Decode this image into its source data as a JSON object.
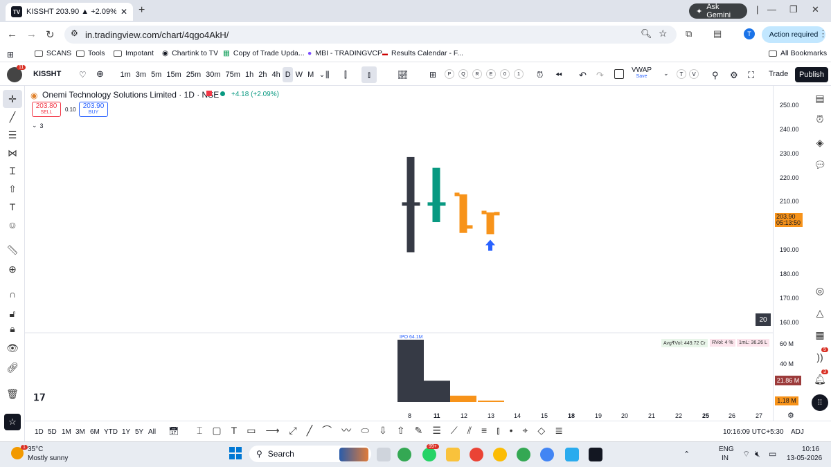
{
  "browser": {
    "tab_title": "KISSHT 203.90 ▲ +2.09% VWAP",
    "tab_icon": "TV",
    "new_tab": "+",
    "ask_gemini": "Ask Gemini",
    "url": "in.tradingview.com/chart/4qgo4AkH/",
    "profile_initial": "T",
    "action_required": "Action required"
  },
  "bookmarks": [
    "SCANS",
    "Tools",
    "Impotant",
    "Chartink to TV",
    "Copy of Trade Upda...",
    "MBI - TRADINGVCP",
    "Results Calendar - F..."
  ],
  "all_bookmarks": "All Bookmarks",
  "tv_toolbar": {
    "symbol": "KISSHT",
    "intervals": [
      "1m",
      "3m",
      "5m",
      "15m",
      "25m",
      "30m",
      "75m",
      "1h",
      "2h",
      "4h",
      "D",
      "W",
      "M"
    ],
    "active_interval": "D",
    "letters": [
      "P",
      "Q",
      "R",
      "E",
      "0",
      "1"
    ],
    "vwap": "VWAP",
    "vwap_save": "Save",
    "extra_letters": [
      "T",
      "V"
    ],
    "trade": "Trade",
    "publish": "Publish",
    "avatar_badge": "11"
  },
  "legend": {
    "title": "Onemi Technology Solutions Limited · 1D · NSE",
    "change": "+4.18 (+2.09%)",
    "sell_price": "203.80",
    "sell_label": "SELL",
    "spread": "0.10",
    "buy_price": "203.90",
    "buy_label": "BUY",
    "indicators_count": "3"
  },
  "price_axis": [
    "250.00",
    "240.00",
    "230.00",
    "220.00",
    "210.00",
    "190.00",
    "180.00",
    "170.00",
    "160.00"
  ],
  "price_tag": {
    "price": "203.90",
    "timer": "05:13:50"
  },
  "time_axis": [
    "8",
    "11",
    "12",
    "13",
    "14",
    "15",
    "18",
    "19",
    "20",
    "21",
    "22",
    "25",
    "26",
    "27"
  ],
  "bold_time_labels": [
    "11",
    "18",
    "25"
  ],
  "badge_20": "20",
  "volume": {
    "ipo_label": "IPO 64.1M",
    "avg_vol": "Avg₹Vol: 449.72 Cr",
    "rvol": "RVol: 4 %",
    "iml": "1mL: 36.26 L",
    "axis": [
      "60 M",
      "40 M"
    ],
    "tag_main": "21.86 M",
    "tag_small": "1.18 M"
  },
  "chart_data": {
    "type": "ohlc",
    "categories": [
      "8",
      "11",
      "12",
      "13"
    ],
    "ohlc": [
      {
        "x": "8",
        "open": 209,
        "high": 228.5,
        "low": 189,
        "close": 209
      },
      {
        "x": "11",
        "open": 209,
        "high": 224,
        "low": 201.5,
        "close": 209
      },
      {
        "x": "12",
        "open": 213,
        "high": 213,
        "low": 197,
        "close": 199.5
      },
      {
        "x": "13",
        "open": 205.5,
        "high": 205.5,
        "low": 196.5,
        "close": 205
      }
    ],
    "volume": [
      64.1,
      21.86,
      6.5,
      1.18
    ],
    "ylim": [
      157,
      255
    ],
    "colors": {
      "down": "#363a45",
      "up": "#089981",
      "orange": "#f7931a",
      "arrow": "#2962ff"
    }
  },
  "bottom_ranges": [
    "1D",
    "5D",
    "1M",
    "3M",
    "6M",
    "YTD",
    "1Y",
    "5Y",
    "All"
  ],
  "clock": "10:16:09 UTC+5:30",
  "adj": "ADJ",
  "taskbar": {
    "temp": "35°C",
    "weather": "Mostly sunny",
    "weather_badge": "1",
    "search": "Search",
    "whatsapp_badge": "99+",
    "lang1": "ENG",
    "lang2": "IN",
    "time": "10:16",
    "date": "13-05-2026"
  },
  "right_badges": [
    "5",
    "3"
  ]
}
